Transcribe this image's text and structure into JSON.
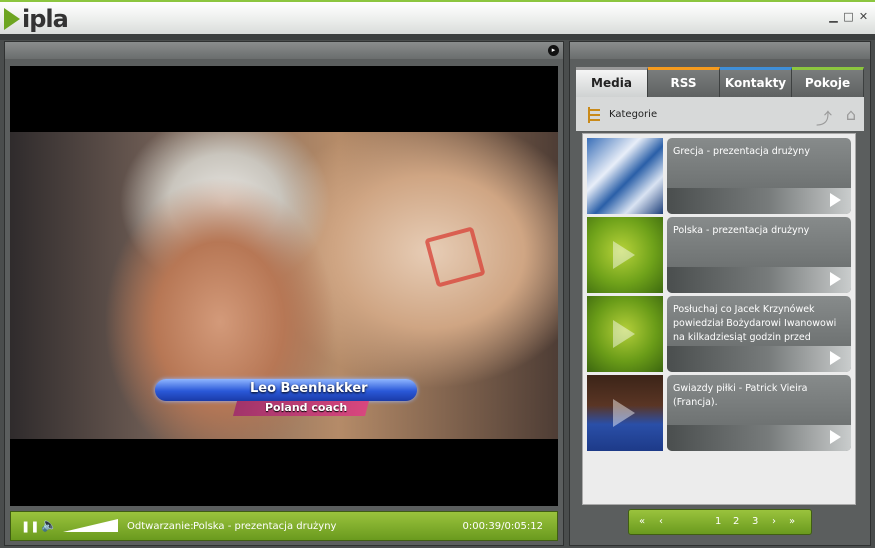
{
  "app": {
    "logo_text": "ipla",
    "accent": "#8cc63f"
  },
  "window_buttons": [
    "minimize",
    "maximize",
    "close"
  ],
  "video": {
    "overlay_name": "Leo Beenhakker",
    "overlay_subtitle": "Poland coach"
  },
  "player": {
    "now_playing_label": "Odtwarzanie:",
    "now_playing_title": "Polska - prezentacja drużyny",
    "time": "0:00:39/0:05:12",
    "volume": 1.0
  },
  "tabs": [
    {
      "label": "Media",
      "active": true
    },
    {
      "label": "RSS"
    },
    {
      "label": "Kontakty"
    },
    {
      "label": "Pokoje"
    }
  ],
  "categories_label": "Kategorie",
  "items": [
    {
      "title": "Grecja - prezentacja drużyny"
    },
    {
      "title": "Polska - prezentacja drużyny"
    },
    {
      "title": "Posłuchaj co Jacek Krzynówek powiedział Bożydarowi Iwanowowi na kilkadziesiąt godzin przed meczem Pols"
    },
    {
      "title": "Gwiazdy piłki - Patrick Vieira (Francja)."
    }
  ],
  "pager": {
    "pages": [
      "1",
      "2",
      "3"
    ]
  }
}
